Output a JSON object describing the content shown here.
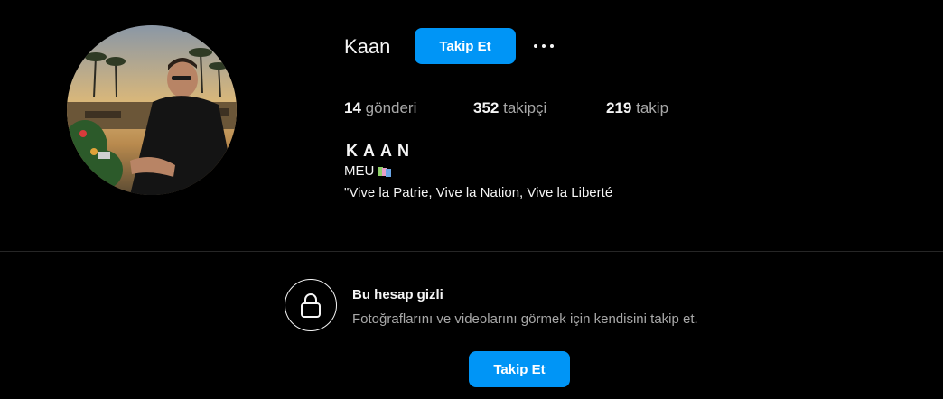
{
  "profile": {
    "username": "Kaan",
    "follow_label": "Takip Et",
    "more_icon": "more-horizontal-icon"
  },
  "stats": {
    "posts_count": "14",
    "posts_label": "gönderi",
    "followers_count": "352",
    "followers_label": "takipçi",
    "following_count": "219",
    "following_label": "takip"
  },
  "bio": {
    "full_name": "KAAN",
    "line1": "MEU",
    "line1_icon": "flag-icon",
    "line2": "\"Vive la Patrie, Vive la Nation, Vive la Liberté"
  },
  "private": {
    "icon": "lock-icon",
    "title": "Bu hesap gizli",
    "description": "Fotoğraflarını ve videolarını görmek için kendisini takip et.",
    "follow_label": "Takip Et"
  },
  "colors": {
    "background": "#000000",
    "accent": "#0095f6",
    "text_primary": "#f5f5f5",
    "text_secondary": "#a8a8a8",
    "divider": "#262626"
  }
}
